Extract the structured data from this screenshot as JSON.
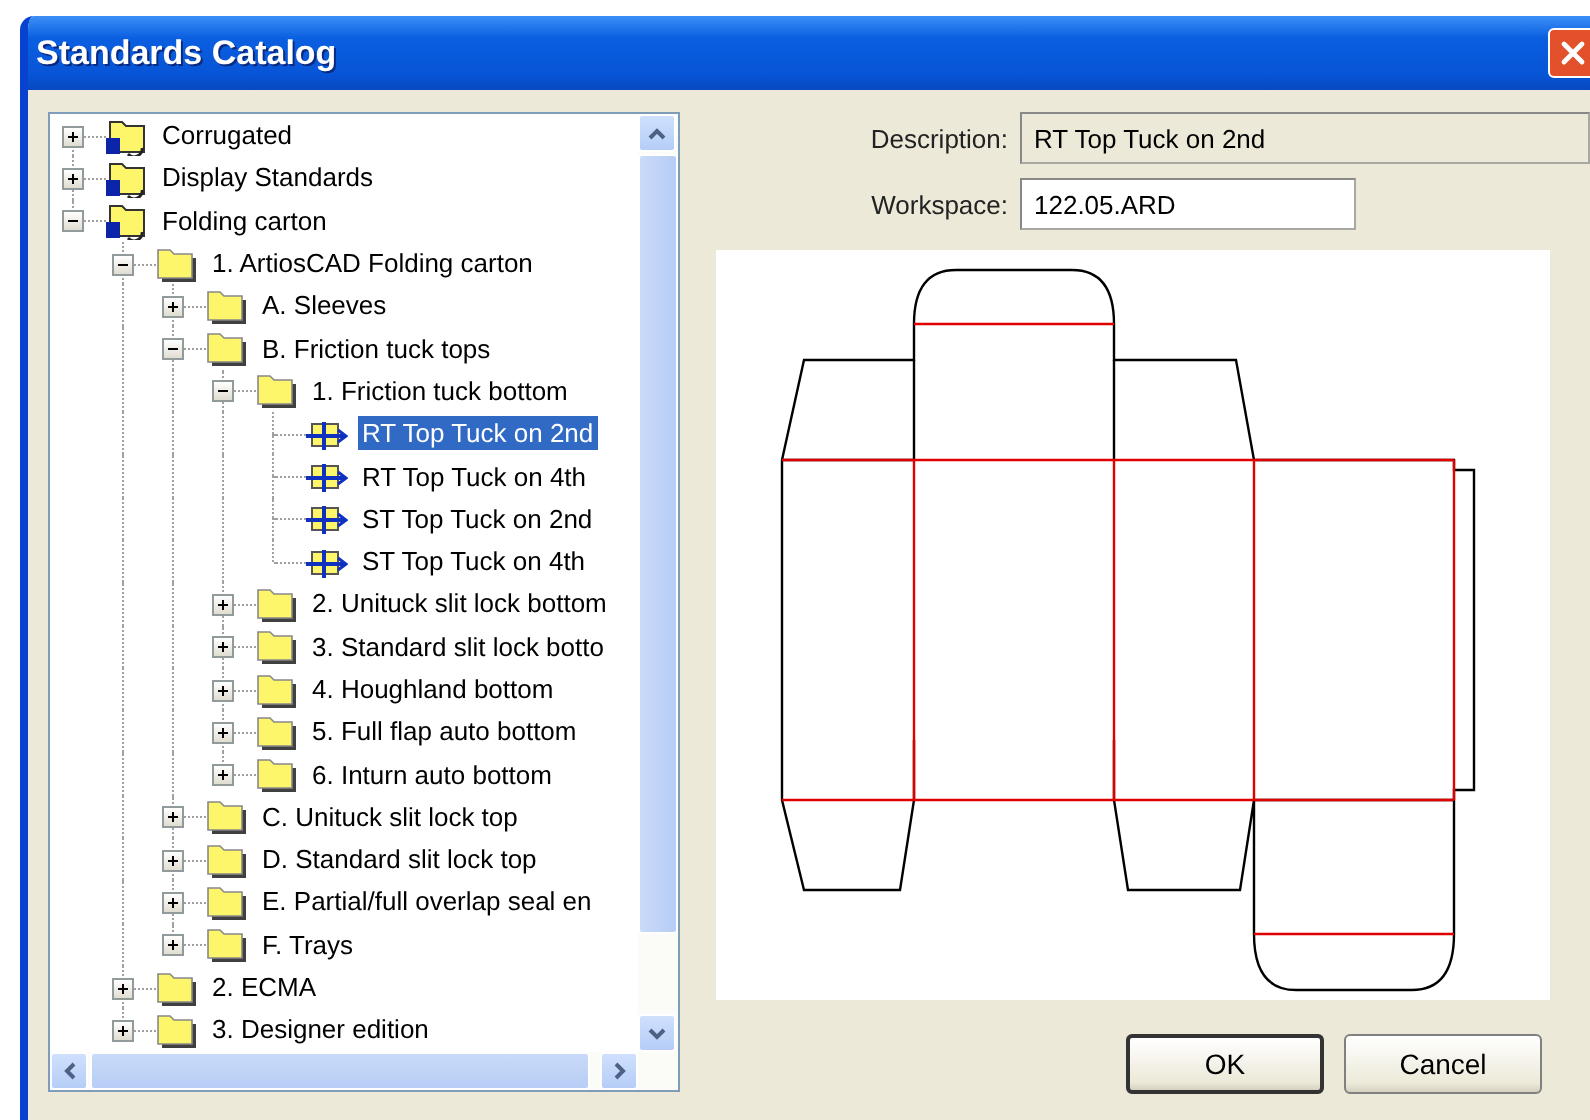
{
  "window": {
    "title": "Standards Catalog"
  },
  "tree": [
    {
      "label": "Corrugated",
      "kind": "catalog",
      "expanded": false,
      "selected": false
    },
    {
      "label": "Display Standards",
      "kind": "catalog",
      "expanded": false,
      "selected": false
    },
    {
      "label": "Folding carton",
      "kind": "catalog",
      "expanded": true,
      "selected": false,
      "children": [
        {
          "label": "1. ArtiosCAD Folding carton",
          "kind": "folder",
          "expanded": true,
          "selected": false,
          "children": [
            {
              "label": "A. Sleeves",
              "kind": "folder",
              "expanded": false,
              "selected": false
            },
            {
              "label": "B. Friction tuck tops",
              "kind": "folder",
              "expanded": true,
              "selected": false,
              "children": [
                {
                  "label": "1. Friction tuck bottom",
                  "kind": "folder",
                  "expanded": true,
                  "selected": false,
                  "children": [
                    {
                      "label": "RT Top Tuck on 2nd",
                      "kind": "design",
                      "selected": true
                    },
                    {
                      "label": "RT Top Tuck on 4th",
                      "kind": "design",
                      "selected": false
                    },
                    {
                      "label": "ST Top Tuck on 2nd",
                      "kind": "design",
                      "selected": false
                    },
                    {
                      "label": "ST Top Tuck on 4th",
                      "kind": "design",
                      "selected": false
                    }
                  ]
                },
                {
                  "label": "2. Unituck slit lock bottom",
                  "kind": "folder",
                  "expanded": false,
                  "selected": false
                },
                {
                  "label": "3. Standard slit lock botto",
                  "kind": "folder",
                  "expanded": false,
                  "selected": false
                },
                {
                  "label": "4. Houghland bottom",
                  "kind": "folder",
                  "expanded": false,
                  "selected": false
                },
                {
                  "label": "5. Full flap auto bottom",
                  "kind": "folder",
                  "expanded": false,
                  "selected": false
                },
                {
                  "label": "6. Inturn auto bottom",
                  "kind": "folder",
                  "expanded": false,
                  "selected": false
                }
              ]
            },
            {
              "label": "C. Unituck slit lock top",
              "kind": "folder",
              "expanded": false,
              "selected": false
            },
            {
              "label": "D. Standard slit lock top",
              "kind": "folder",
              "expanded": false,
              "selected": false
            },
            {
              "label": "E. Partial/full overlap seal en",
              "kind": "folder",
              "expanded": false,
              "selected": false
            },
            {
              "label": "F. Trays",
              "kind": "folder",
              "expanded": false,
              "selected": false
            }
          ]
        },
        {
          "label": "2. ECMA",
          "kind": "folder",
          "expanded": false,
          "selected": false
        },
        {
          "label": "3. Designer edition",
          "kind": "folder",
          "expanded": false,
          "selected": false
        }
      ]
    }
  ],
  "description": {
    "label": "Description:",
    "value": "RT Top Tuck on 2nd"
  },
  "workspace": {
    "label": "Workspace:",
    "value": "122.05.ARD"
  },
  "buttons": [
    "OK",
    "Cancel"
  ]
}
